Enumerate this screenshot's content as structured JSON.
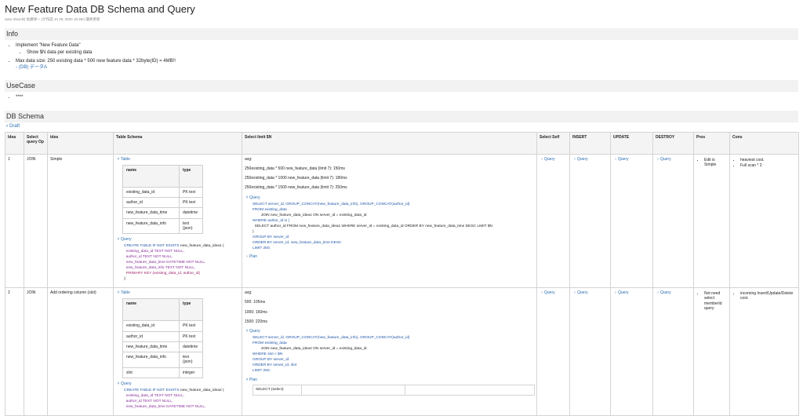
{
  "page": {
    "title": "New Feature Data DB Schema and Query",
    "meta": "Sato Shuichi| 佐藤修一 |が作成 10 28, 2020 15:39に最終更新"
  },
  "info": {
    "heading": "Info",
    "item1": "Implement \"New Feature Data\"",
    "item1_sub": "Show $N data per existing data",
    "item2": "Max data size: 250 existing data * 500 new feature data * 32byte(ID) = 4MB!!",
    "item2_link": "(DB) データA"
  },
  "usecase": {
    "heading": "UseCase",
    "item1": "****"
  },
  "schema": {
    "heading": "DB Schema",
    "draft": "Draft"
  },
  "table": {
    "headers": [
      "Idea",
      "Select query Op",
      "idea",
      "Table Schema",
      "Select limit $N",
      "Select Self",
      "INSERT",
      "UPDATE",
      "DESTROY",
      "Pros",
      "Cons"
    ],
    "table_toggle": "Table",
    "query_toggle": "Query",
    "plan_toggle": "Plan",
    "inner_headers": [
      "name",
      "type"
    ],
    "rows": [
      {
        "idea": "1",
        "op": "JOIN",
        "desc": "Simple",
        "schema": [
          [
            "existing_data_id",
            "PK text"
          ],
          [
            "author_id",
            "PK text"
          ],
          [
            "new_feature_data_time",
            "datetime"
          ],
          [
            "new_feature_data_info",
            "text (json)"
          ]
        ],
        "create": {
          "l1_kw": "CREATE TABLE IF NOT EXISTS",
          "l1_name": "new_feature_data_idea1 (",
          "l2": "existing_data_id TEXT NOT NULL,",
          "l3": "author_id TEXT NOT NULL,",
          "l4": "new_feature_data_time DATETIME NOT NULL,",
          "l5": "new_feature_data_info TEXT NOT NULL,",
          "l6": "PRIMARY KEY (existing_data_id, author_id)",
          "l7": ");"
        },
        "avg": [
          "avg:",
          "250existing_data * 500 new_feature_data (limit 7): 150ms",
          "250existing_data * 1000 new_feature_data (limit 7): 180ms",
          "250existing_data * 1500 new_feature_data (limit 7): 250ms"
        ],
        "query": {
          "l1": "SELECT server_id, GROUP_CONCAT(new_feature_data_info), GROUP_CONCAT(author_id)",
          "l2": "FROM existing_data",
          "l3": "JOIN new_feature_data_idea1 ON server_id = existing_data_id",
          "l4": "WHERE author_id in (",
          "l5": "SELECT author_id FROM new_feature_data_idea1 WHERE server_id = existing_data_id ORDER BY new_feature_data_time DESC LIMIT $N",
          "l6": ")",
          "l7": "GROUP BY server_id",
          "l8": "ORDER BY server_id, new_feature_data_time DESC",
          "l9": "LIMIT 250;"
        },
        "pros": "Edit is Simple",
        "cons1": "heaviest cost.",
        "cons2": "Full scan * 2"
      },
      {
        "idea": "2",
        "op": "JOIN",
        "desc": "Add ordering column (slot)",
        "schema": [
          [
            "existing_data_id",
            "PK text"
          ],
          [
            "author_id",
            "PK text"
          ],
          [
            "new_feature_data_time",
            "datetime"
          ],
          [
            "new_feature_data_info",
            "text (json)"
          ],
          [
            "slot",
            "integer"
          ]
        ],
        "create": {
          "l1_kw": "CREATE TABLE IF NOT EXISTS",
          "l1_name": "new_feature_data_idea2 (",
          "l2": "existing_data_id TEXT NOT NULL,",
          "l3": "author_id TEXT NOT NULL,",
          "l4": "new_feature_data_time DATETIME NOT NULL,"
        },
        "avg": [
          "avg:",
          "500: 105ms",
          "1000: 160ms",
          "1500: 220ms"
        ],
        "query": {
          "l1": "SELECT server_id, GROUP_CONCAT(new_feature_data_info), GROUP_CONCAT(author_id)",
          "l2": "FROM existing_data",
          "l3": "JOIN new_feature_data_idea2 ON server_id = existing_data_id",
          "l4": "WHERE slot < $N",
          "l5": "GROUP BY server_id",
          "l6": "ORDER BY server_id, slot",
          "l7": "LIMIT 250;"
        },
        "plan_cell": "SELECT (select)",
        "pros": "Not need select memberId query",
        "cons": "incoming Insert/Update/Delete cost."
      }
    ]
  }
}
